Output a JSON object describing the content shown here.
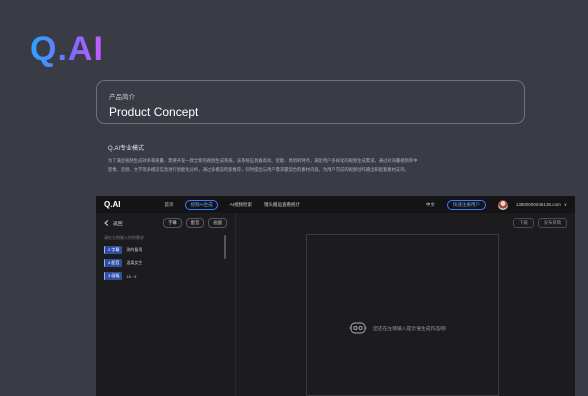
{
  "logo": "Q.AI",
  "concept": {
    "subtitle": "产品简介",
    "title": "Product Concept"
  },
  "intro": {
    "title": "Q.AI专业模式",
    "line1": "为了满足视频生成效率和质量，需要开发一款全新的视频生成系统。该系统应具备高效、智能、易用的特点，满足用户多样化的视频生成需求。通过对海量视频库中",
    "line2": "影像、音频、文字等多模态信息进行智能化分析，通过多模态检索推荐，同时提出与用户需求最契合的素材内容。为用户完成的视频创作输出和配套素材支持。"
  },
  "app": {
    "logo": "Q.AI",
    "nav": [
      "首页",
      "视频AI生成",
      "AI视频检索",
      "镜头搬运查看统计"
    ],
    "lang": "中文",
    "user_type": "快速注册用户",
    "email": "13800000046135.com",
    "caret": "∨",
    "back_label": "返回",
    "tools": [
      "字幕",
      "配音",
      "画面"
    ],
    "list_hint": "请在左侧输入你的需求",
    "rows": [
      {
        "tag": "2 字幕",
        "text": "测的备用"
      },
      {
        "tag": "4 配音",
        "text": "温柔女生"
      },
      {
        "tag": "3 画幅",
        "text": "16 : 9"
      }
    ],
    "right_tools": [
      "下载",
      "发布草稿"
    ],
    "empty_text": "您还在左侧输入提示语生成作品吧!"
  },
  "colors": {
    "accent": "#3e7bff",
    "background": "#3a3c45",
    "app_bg": "#1c1c1e"
  }
}
